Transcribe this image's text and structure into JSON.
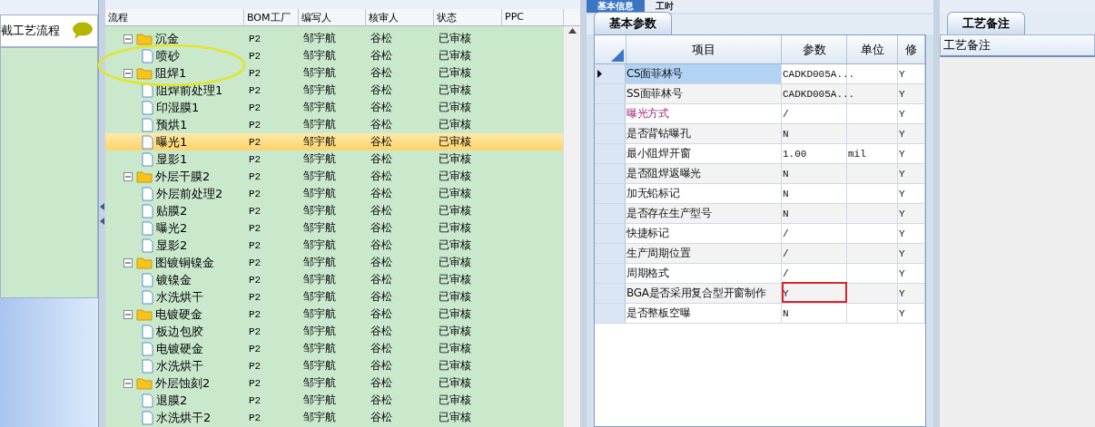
{
  "left_panel": {
    "title": "截工艺流程"
  },
  "flow_table": {
    "tree_column": "流程",
    "columns": [
      "BOM工厂",
      "编写人",
      "核审人",
      "状态",
      "PPC"
    ],
    "rows": [
      {
        "kind": "folder",
        "name": "沉金",
        "expanded": true,
        "selected": false,
        "cells": [
          "P2",
          "邹宇航",
          "谷松",
          "已审核"
        ],
        "children": [
          {
            "kind": "step",
            "name": "喷砂",
            "selected": false,
            "cells": [
              "P2",
              "邹宇航",
              "谷松",
              "已审核"
            ]
          }
        ]
      },
      {
        "kind": "folder",
        "name": "阻焊1",
        "expanded": true,
        "selected": false,
        "cells": [
          "P2",
          "邹宇航",
          "谷松",
          "已审核"
        ],
        "children": [
          {
            "kind": "step",
            "name": "阻焊前处理1",
            "selected": false,
            "cells": [
              "P2",
              "邹宇航",
              "谷松",
              "已审核"
            ]
          },
          {
            "kind": "step",
            "name": "印湿膜1",
            "selected": false,
            "cells": [
              "P2",
              "邹宇航",
              "谷松",
              "已审核"
            ]
          },
          {
            "kind": "step",
            "name": "预烘1",
            "selected": false,
            "cells": [
              "P2",
              "邹宇航",
              "谷松",
              "已审核"
            ]
          },
          {
            "kind": "step",
            "name": "曝光1",
            "selected": true,
            "cells": [
              "P2",
              "邹宇航",
              "谷松",
              "已审核"
            ]
          },
          {
            "kind": "step",
            "name": "显影1",
            "selected": false,
            "cells": [
              "P2",
              "邹宇航",
              "谷松",
              "已审核"
            ]
          }
        ]
      },
      {
        "kind": "folder",
        "name": "外层干膜2",
        "expanded": true,
        "selected": false,
        "cells": [
          "P2",
          "邹宇航",
          "谷松",
          "已审核"
        ],
        "children": [
          {
            "kind": "step",
            "name": "外层前处理2",
            "selected": false,
            "cells": [
              "P2",
              "邹宇航",
              "谷松",
              "已审核"
            ]
          },
          {
            "kind": "step",
            "name": "贴膜2",
            "selected": false,
            "cells": [
              "P2",
              "邹宇航",
              "谷松",
              "已审核"
            ]
          },
          {
            "kind": "step",
            "name": "曝光2",
            "selected": false,
            "cells": [
              "P2",
              "邹宇航",
              "谷松",
              "已审核"
            ]
          },
          {
            "kind": "step",
            "name": "显影2",
            "selected": false,
            "cells": [
              "P2",
              "邹宇航",
              "谷松",
              "已审核"
            ]
          }
        ]
      },
      {
        "kind": "folder",
        "name": "图镀铜镍金",
        "expanded": true,
        "selected": false,
        "cells": [
          "P2",
          "邹宇航",
          "谷松",
          "已审核"
        ],
        "children": [
          {
            "kind": "step",
            "name": "镀镍金",
            "selected": false,
            "cells": [
              "P2",
              "邹宇航",
              "谷松",
              "已审核"
            ]
          },
          {
            "kind": "step",
            "name": "水洗烘干",
            "selected": false,
            "cells": [
              "P2",
              "邹宇航",
              "谷松",
              "已审核"
            ]
          }
        ]
      },
      {
        "kind": "folder",
        "name": "电镀硬金",
        "expanded": true,
        "selected": false,
        "cells": [
          "P2",
          "邹宇航",
          "谷松",
          "已审核"
        ],
        "children": [
          {
            "kind": "step",
            "name": "板边包胶",
            "selected": false,
            "cells": [
              "P2",
              "邹宇航",
              "谷松",
              "已审核"
            ]
          },
          {
            "kind": "step",
            "name": "电镀硬金",
            "selected": false,
            "cells": [
              "P2",
              "邹宇航",
              "谷松",
              "已审核"
            ]
          },
          {
            "kind": "step",
            "name": "水洗烘干",
            "selected": false,
            "cells": [
              "P2",
              "邹宇航",
              "谷松",
              "已审核"
            ]
          }
        ]
      },
      {
        "kind": "folder",
        "name": "外层蚀刻2",
        "expanded": true,
        "selected": false,
        "cells": [
          "P2",
          "邹宇航",
          "谷松",
          "已审核"
        ],
        "children": [
          {
            "kind": "step",
            "name": "退膜2",
            "selected": false,
            "cells": [
              "P2",
              "邹宇航",
              "谷松",
              "已审核"
            ]
          },
          {
            "kind": "step",
            "name": "水洗烘干2",
            "selected": false,
            "cells": [
              "P2",
              "邹宇航",
              "谷松",
              "已审核"
            ]
          }
        ]
      }
    ]
  },
  "main_tabs": [
    {
      "label": "基本信息",
      "selected": true
    },
    {
      "label": "工时",
      "selected": false
    }
  ],
  "sub_tabs": [
    {
      "label": "基本参数",
      "selected": true
    }
  ],
  "param_table": {
    "columns": [
      "项目",
      "参数",
      "单位",
      "修"
    ],
    "rows": [
      {
        "item": "CS面菲林号",
        "value": "CADKD005A...",
        "unit": "",
        "modify": "Y",
        "selected": true
      },
      {
        "item": "SS面菲林号",
        "value": "CADKD005A...",
        "unit": "",
        "modify": "Y",
        "selected": false
      },
      {
        "item": "曝光方式",
        "highlighted": true,
        "value": "/",
        "unit": "",
        "modify": "Y",
        "selected": false
      },
      {
        "item": "是否背钻曝孔",
        "value": "N",
        "unit": "",
        "modify": "Y",
        "selected": false
      },
      {
        "item": "最小阻焊开窗",
        "value": "1.00",
        "unit": "mil",
        "modify": "Y",
        "selected": false
      },
      {
        "item": "是否阻焊返曝光",
        "value": "N",
        "unit": "",
        "modify": "Y",
        "selected": false
      },
      {
        "item": "加无铅标记",
        "value": "N",
        "unit": "",
        "modify": "Y",
        "selected": false
      },
      {
        "item": "是否存在生产型号",
        "value": "N",
        "unit": "",
        "modify": "Y",
        "selected": false
      },
      {
        "item": "快捷标记",
        "value": "/",
        "unit": "",
        "modify": "Y",
        "selected": false
      },
      {
        "item": "生产周期位置",
        "value": "/",
        "unit": "",
        "modify": "Y",
        "selected": false
      },
      {
        "item": "周期格式",
        "value": "/",
        "unit": "",
        "modify": "Y",
        "selected": false
      },
      {
        "item": "BGA是否采用复合型开窗制作",
        "value": "Y",
        "unit": "",
        "modify": "Y",
        "selected": false,
        "marked": true
      },
      {
        "item": "是否整板空曝",
        "value": "N",
        "unit": "",
        "modify": "Y",
        "selected": false
      }
    ]
  },
  "notes_panel": {
    "tab": "工艺备注",
    "header": "工艺备注"
  }
}
